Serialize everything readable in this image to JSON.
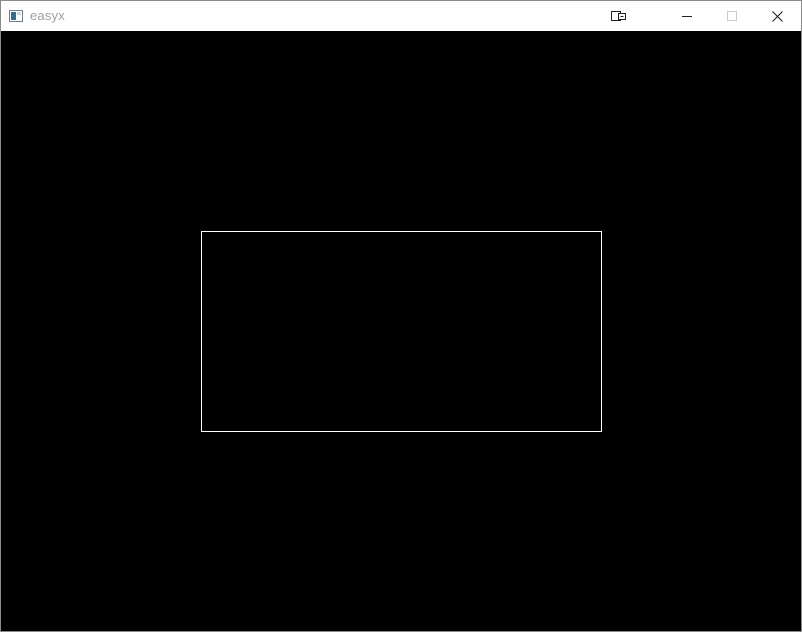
{
  "window": {
    "title": "easyx"
  },
  "titlebar": {
    "icons": [
      "app-icon",
      "pin-icon",
      "minimize-icon",
      "maximize-icon",
      "close-icon"
    ],
    "maximize_enabled": false
  },
  "canvas": {
    "background_color": "#000000",
    "shape": {
      "type": "rectangle",
      "stroke_color": "#ffffff",
      "fill": "none"
    }
  }
}
